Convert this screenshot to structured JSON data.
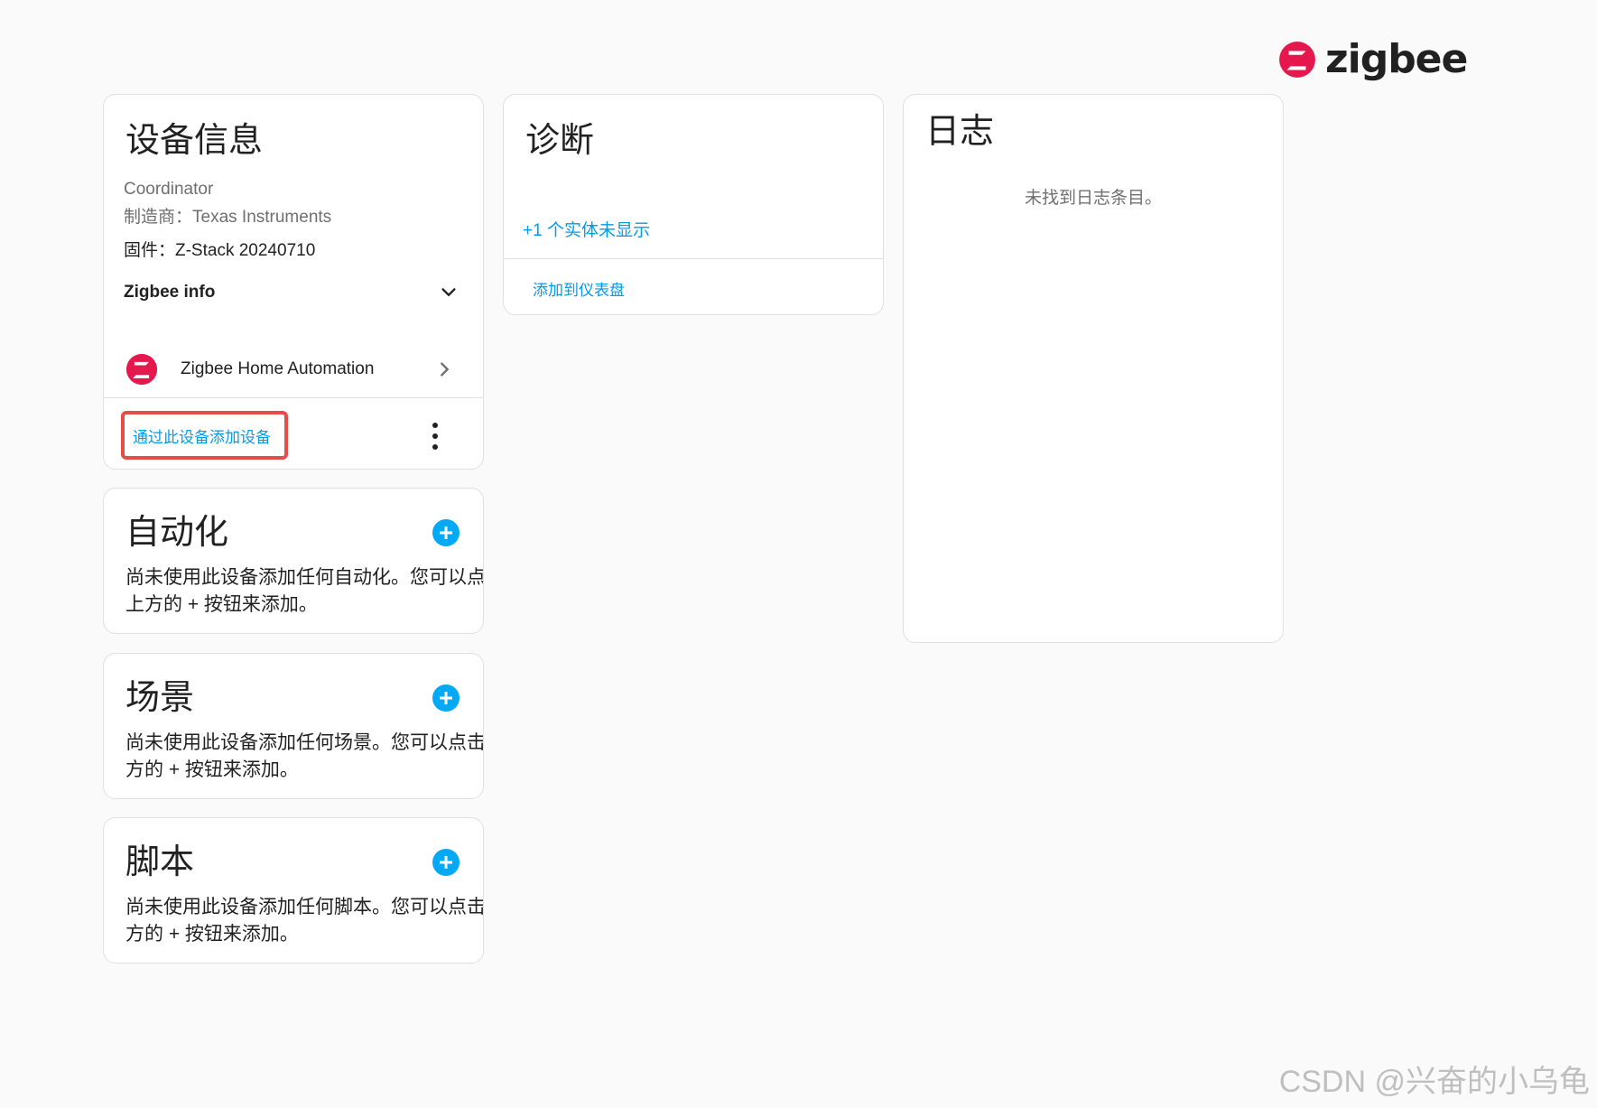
{
  "logo": {
    "text": "zigbee",
    "icon": "zigbee-logo-icon",
    "color": "#e5184e"
  },
  "device_info": {
    "title": "设备信息",
    "model": "Coordinator",
    "manufacturer": "制造商：Texas Instruments",
    "firmware": "固件：Z-Stack 20240710",
    "expander_label": "Zigbee info",
    "integration_label": "Zigbee Home Automation",
    "add_device_label": "通过此设备添加设备"
  },
  "diagnostics": {
    "title": "诊断",
    "hidden_entities": "+1 个实体未显示",
    "add_to_dashboard": "添加到仪表盘"
  },
  "logbook": {
    "title": "日志",
    "empty_text": "未找到日志条目。"
  },
  "automations": {
    "title": "自动化",
    "description": "尚未使用此设备添加任何自动化。您可以点击上方的 + 按钮来添加。"
  },
  "scenes": {
    "title": "场景",
    "description": "尚未使用此设备添加任何场景。您可以点击上方的 + 按钮来添加。"
  },
  "scripts": {
    "title": "脚本",
    "description": "尚未使用此设备添加任何脚本。您可以点击上方的 + 按钮来添加。"
  },
  "colors": {
    "accent": "#03a9f4",
    "link": "#039be5",
    "highlight": "#e64d47"
  },
  "watermark": "CSDN @兴奋的小乌龟"
}
